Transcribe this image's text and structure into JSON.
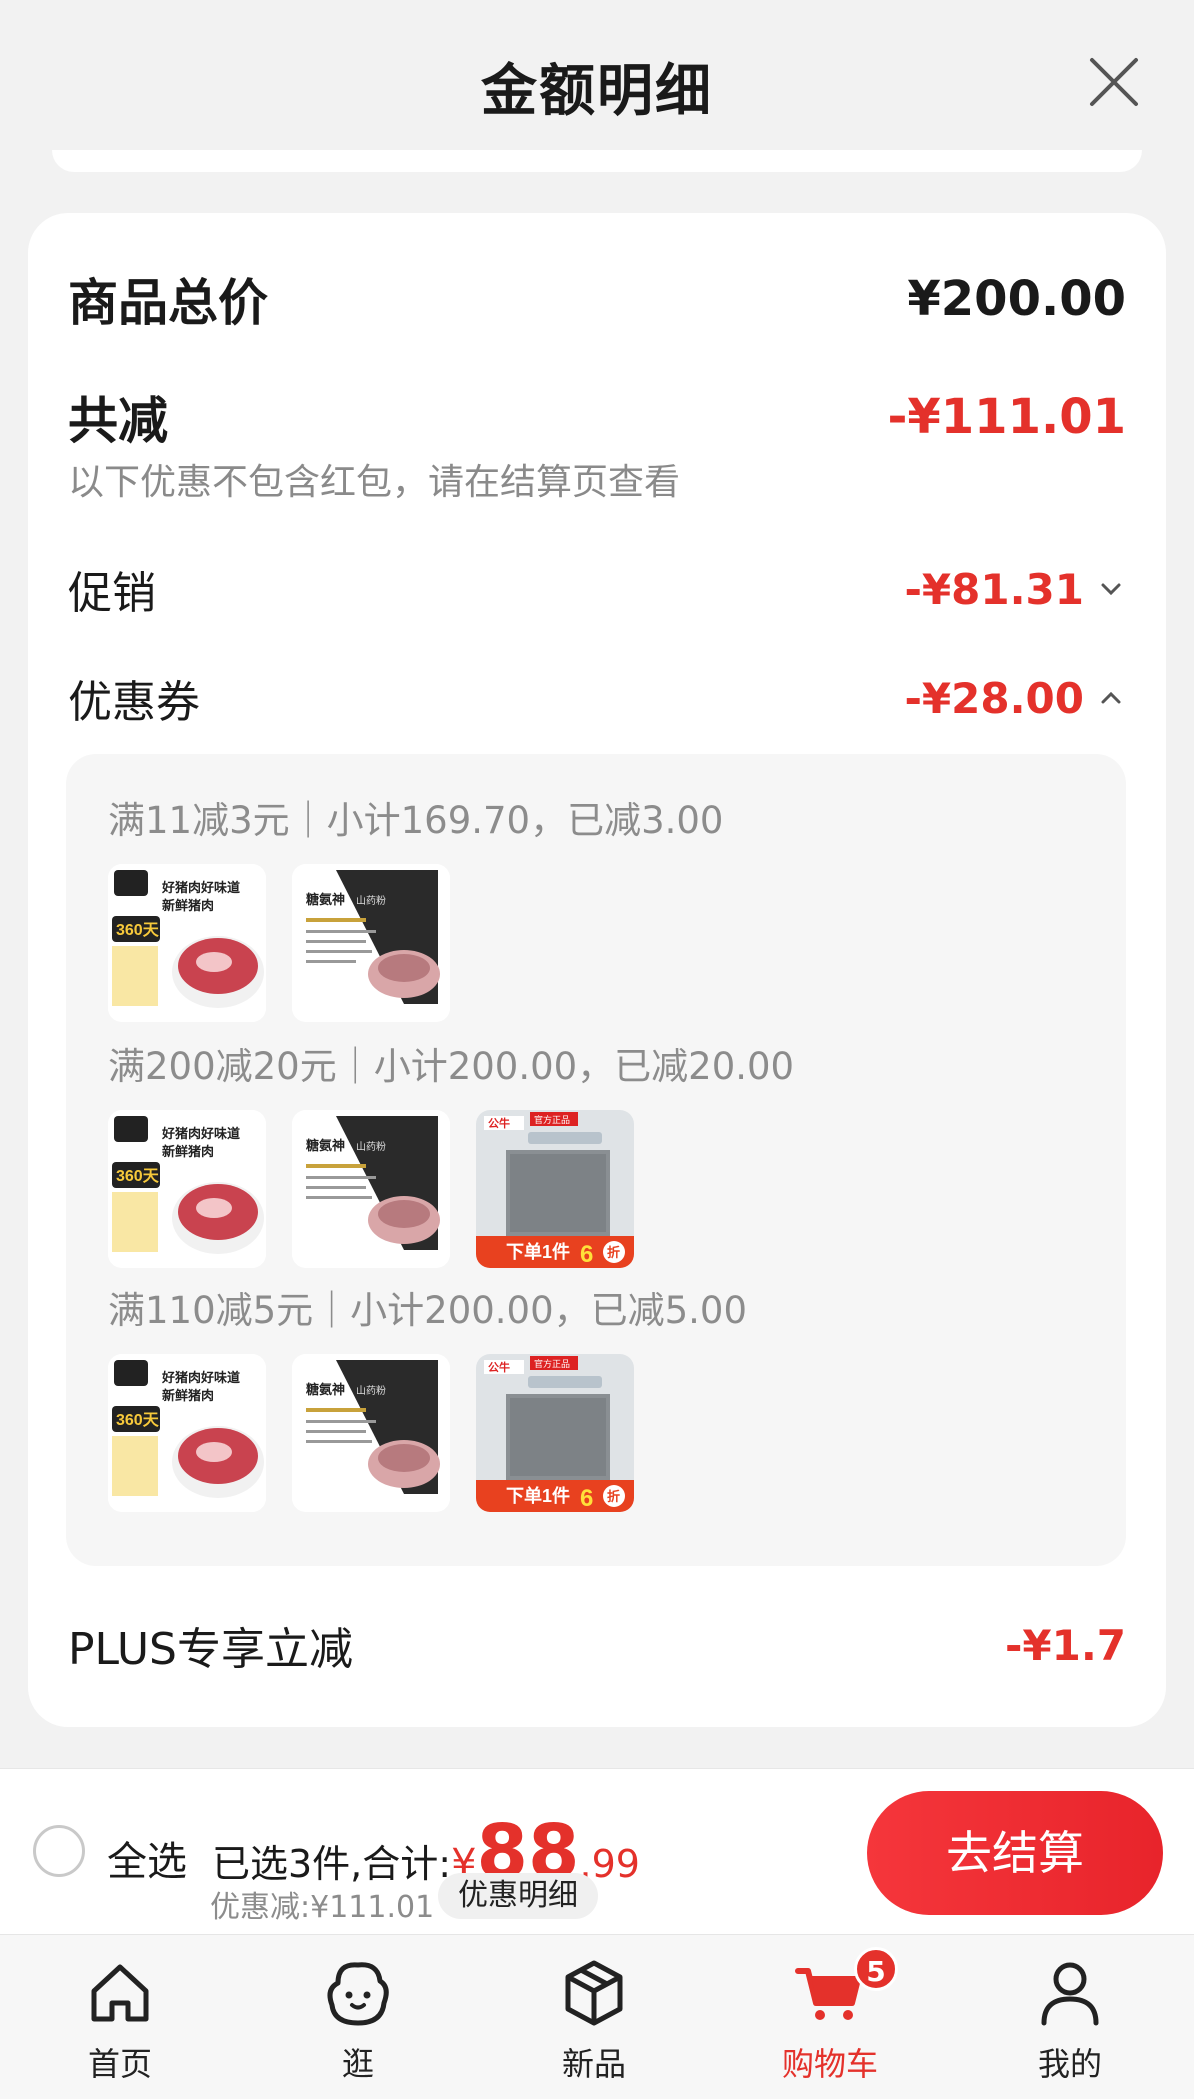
{
  "header": {
    "title": "金额明细"
  },
  "summary": {
    "total_label": "商品总价",
    "total_value": "¥200.00",
    "reduce_label": "共减",
    "reduce_value": "-¥111.01",
    "note": "以下优惠不包含红包，请在结算页查看",
    "promo_label": "促销",
    "promo_value": "-¥81.31",
    "coupon_label": "优惠券",
    "coupon_value": "-¥28.00",
    "coupons": [
      {
        "text": "满11减3元｜小计169.70，已减3.00"
      },
      {
        "text": "满200减20元｜小计200.00，已减20.00"
      },
      {
        "text": "满110减5元｜小计200.00，已减5.00"
      }
    ],
    "plus_label": "PLUS专享立减",
    "plus_value": "-¥1.7"
  },
  "products": {
    "pork": {
      "headline1": "好猪肉好味道",
      "headline2": "新鲜猪肉",
      "days": "360天"
    },
    "yam": {
      "brand": "糖氨神",
      "sub": "山药粉"
    },
    "gongniu": {
      "brand": "公牛",
      "tag": "官方正品",
      "banner": "下单1件",
      "discount_num": "6",
      "discount_unit": "折"
    }
  },
  "checkout": {
    "select_all": "全选",
    "selected_text": "已选3件,合计:",
    "currency": "¥",
    "total_int": "88",
    "total_dec": ".99",
    "discount_text": "优惠减:¥111.01",
    "detail_button": "优惠明细",
    "pay_button": "去结算"
  },
  "tabbar": {
    "tabs": [
      {
        "label": "首页",
        "icon": "home-icon"
      },
      {
        "label": "逛",
        "icon": "face-icon"
      },
      {
        "label": "新品",
        "icon": "box-icon"
      },
      {
        "label": "购物车",
        "icon": "cart-icon",
        "badge": "5",
        "active": true
      },
      {
        "label": "我的",
        "icon": "user-icon"
      }
    ]
  },
  "colors": {
    "accent": "#e4312b",
    "background": "#f2f2f2"
  }
}
